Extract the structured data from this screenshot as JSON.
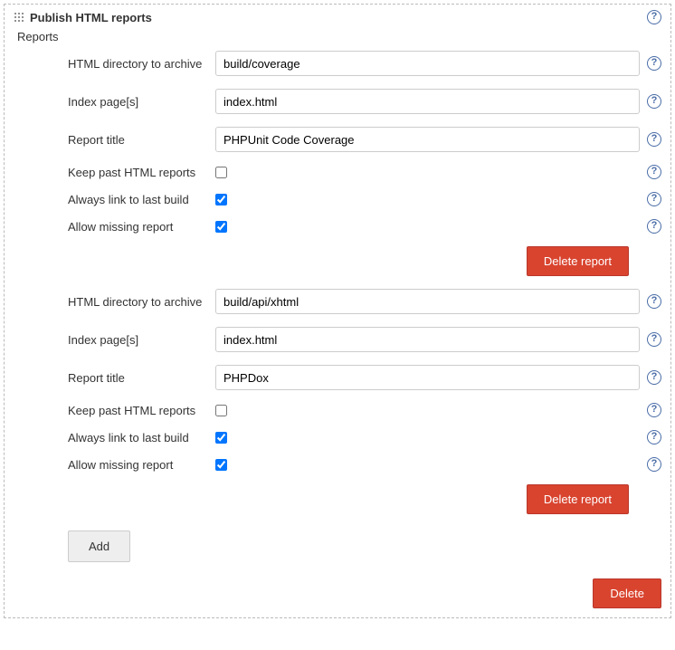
{
  "panel": {
    "title": "Publish HTML reports",
    "section_label": "Reports",
    "add_button": "Add",
    "delete_button": "Delete"
  },
  "labels": {
    "html_dir": "HTML directory to archive",
    "index_page": "Index page[s]",
    "report_title": "Report title",
    "keep_past": "Keep past HTML reports",
    "always_link": "Always link to last build",
    "allow_missing": "Allow missing report",
    "delete_report": "Delete report"
  },
  "reports": [
    {
      "html_dir": "build/coverage",
      "index_page": "index.html",
      "report_title": "PHPUnit Code Coverage",
      "keep_past": false,
      "always_link": true,
      "allow_missing": true
    },
    {
      "html_dir": "build/api/xhtml",
      "index_page": "index.html",
      "report_title": "PHPDox",
      "keep_past": false,
      "always_link": true,
      "allow_missing": true
    }
  ]
}
